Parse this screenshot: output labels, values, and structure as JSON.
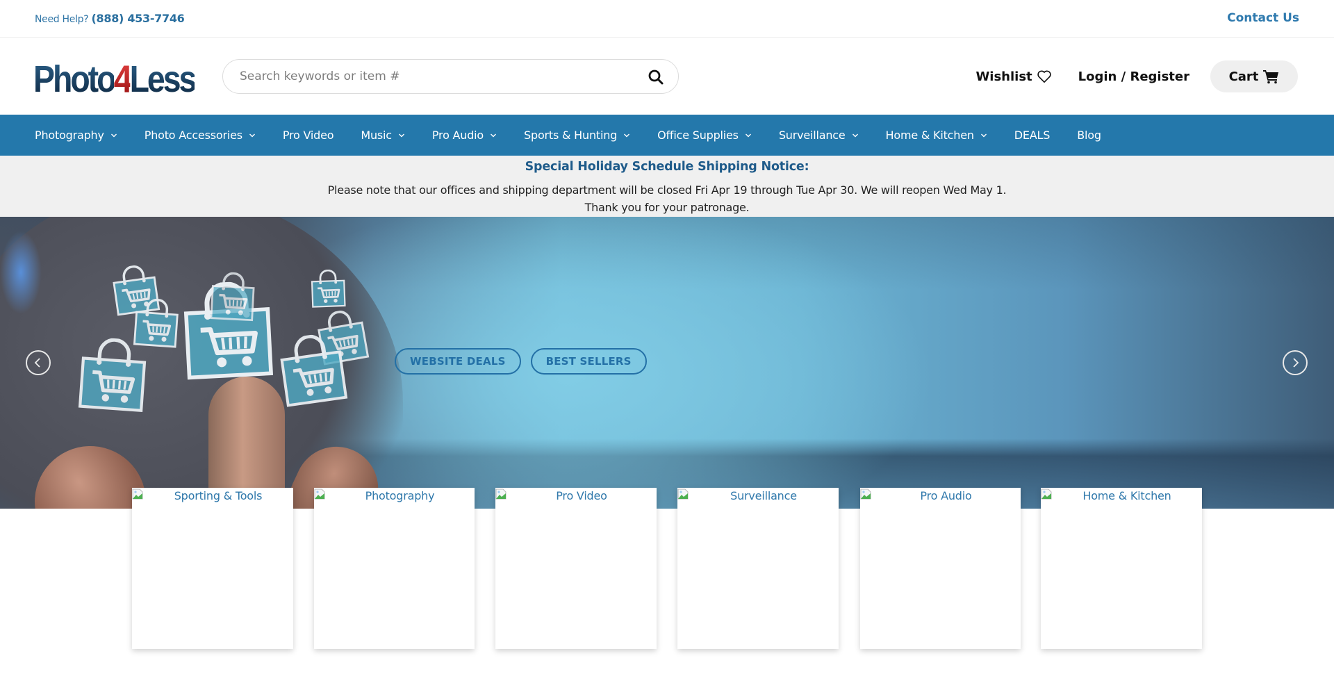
{
  "topbar": {
    "help_label": "Need Help?",
    "phone": "(888) 453-7746",
    "contact_label": "Contact Us"
  },
  "header": {
    "logo": {
      "part1": "Photo",
      "part2": "4",
      "part3": "Less"
    },
    "search": {
      "placeholder": "Search keywords or item #",
      "value": "",
      "icon": "search-icon"
    },
    "wishlist_label": "Wishlist",
    "wishlist_icon": "heart-icon",
    "login_label": "Login / Register",
    "cart_label": "Cart",
    "cart_icon": "cart-icon"
  },
  "nav": {
    "items": [
      {
        "label": "Photography",
        "has_dropdown": true
      },
      {
        "label": "Photo Accessories",
        "has_dropdown": true
      },
      {
        "label": "Pro Video",
        "has_dropdown": false
      },
      {
        "label": "Music",
        "has_dropdown": true
      },
      {
        "label": "Pro Audio",
        "has_dropdown": true
      },
      {
        "label": "Sports & Hunting",
        "has_dropdown": true
      },
      {
        "label": "Office Supplies",
        "has_dropdown": true
      },
      {
        "label": "Surveillance",
        "has_dropdown": true
      },
      {
        "label": "Home & Kitchen",
        "has_dropdown": true
      },
      {
        "label": "DEALS",
        "has_dropdown": false
      },
      {
        "label": "Blog",
        "has_dropdown": false
      }
    ]
  },
  "notice": {
    "title": "Special Holiday Schedule Shipping Notice:",
    "line1": "Please note that our offices and shipping department will be closed Fri Apr 19 through Tue Apr 30. We will reopen Wed May 1.",
    "line2": "Thank you for your patronage."
  },
  "hero": {
    "buttons": [
      "WEBSITE DEALS",
      "BEST SELLERS"
    ],
    "prev_icon": "chevron-left-icon",
    "next_icon": "chevron-right-icon"
  },
  "categories": [
    {
      "label": "Sporting & Tools"
    },
    {
      "label": "Photography"
    },
    {
      "label": "Pro Video"
    },
    {
      "label": "Surveillance"
    },
    {
      "label": "Pro Audio"
    },
    {
      "label": "Home & Kitchen"
    }
  ],
  "colors": {
    "brand_blue": "#2478ab",
    "link_blue": "#2f78ab",
    "notice_title": "#1f5b8a",
    "notice_bg": "#f0f0f0",
    "logo_red": "#c42020",
    "logo_navy": "#163a5c"
  }
}
